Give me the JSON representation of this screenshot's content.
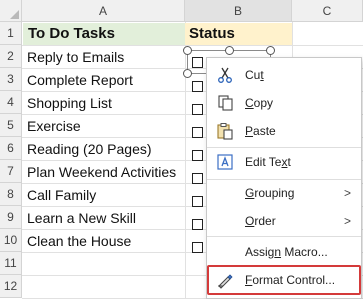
{
  "columns": [
    "A",
    "B",
    "C"
  ],
  "rows": [
    "1",
    "2",
    "3",
    "4",
    "5",
    "6",
    "7",
    "8",
    "9",
    "10",
    "11",
    "12"
  ],
  "header": {
    "a": "To Do Tasks",
    "b": "Status"
  },
  "tasks": [
    "Reply to Emails",
    "Complete Report",
    "Shopping List",
    "Exercise",
    "Reading (20 Pages)",
    "Plan Weekend Activities",
    "Call Family",
    "Learn a New Skill",
    "Clean the House"
  ],
  "context_menu": {
    "items": [
      {
        "pre": "Cu",
        "acc": "t",
        "post": "",
        "icon": "scissors-icon"
      },
      {
        "pre": "",
        "acc": "C",
        "post": "opy",
        "icon": "copy-icon"
      },
      {
        "pre": "",
        "acc": "P",
        "post": "aste",
        "icon": "paste-icon"
      },
      {
        "pre": "Edit Te",
        "acc": "x",
        "post": "t",
        "icon": "edit-text-icon"
      },
      {
        "pre": "",
        "acc": "G",
        "post": "rouping",
        "icon": ""
      },
      {
        "pre": "",
        "acc": "O",
        "post": "rder",
        "icon": ""
      },
      {
        "pre": "Assig",
        "acc": "n",
        "post": " Macro...",
        "icon": ""
      },
      {
        "pre": "",
        "acc": "F",
        "post": "ormat Control...",
        "icon": "format-control-icon"
      }
    ],
    "submenu_arrow": ">"
  },
  "colors": {
    "header_a_fill": "#e2efda",
    "header_b_fill": "#fff2cc",
    "highlight_border": "#d43a3a",
    "paste_accent": "#c9a040",
    "edit_text_accent": "#3b6fc4"
  }
}
